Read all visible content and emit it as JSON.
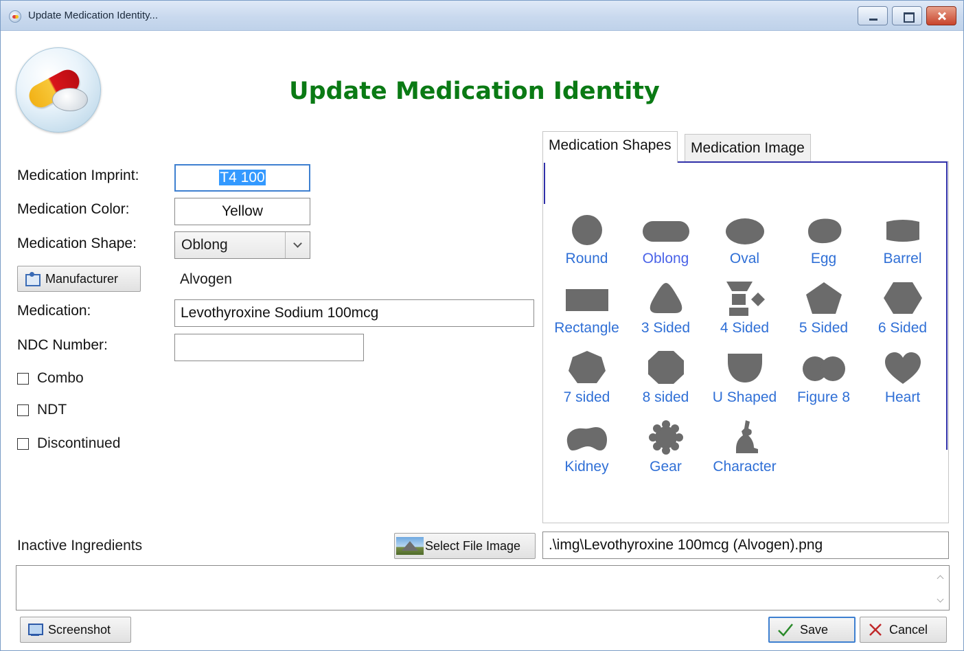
{
  "window": {
    "title": "Update Medication Identity...",
    "heading": "Update Medication Identity"
  },
  "form": {
    "imprint": {
      "label": "Medication Imprint:",
      "value": "T4 100"
    },
    "color": {
      "label": "Medication Color:",
      "value": "Yellow"
    },
    "shape": {
      "label": "Medication Shape:",
      "value": "Oblong"
    },
    "manufacturer": {
      "button": "Manufacturer",
      "value": "Alvogen"
    },
    "medication": {
      "label": "Medication:",
      "value": "Levothyroxine Sodium 100mcg"
    },
    "ndc": {
      "label": "NDC Number:",
      "value": ""
    },
    "checkboxes": {
      "combo": {
        "label": "Combo",
        "checked": false
      },
      "ndt": {
        "label": "NDT",
        "checked": false
      },
      "discontinued": {
        "label": "Discontinued",
        "checked": false
      }
    }
  },
  "tabs": {
    "shapes": "Medication Shapes",
    "image": "Medication Image"
  },
  "shapes": [
    {
      "label": "Round",
      "icon": "round-shape-icon"
    },
    {
      "label": "Oblong",
      "icon": "oblong-shape-icon",
      "selected": true
    },
    {
      "label": "Oval",
      "icon": "oval-shape-icon"
    },
    {
      "label": "Egg",
      "icon": "egg-shape-icon"
    },
    {
      "label": "Barrel",
      "icon": "barrel-shape-icon"
    },
    {
      "label": "Rectangle",
      "icon": "rectangle-shape-icon"
    },
    {
      "label": "3 Sided",
      "icon": "three-sided-shape-icon"
    },
    {
      "label": "4 Sided",
      "icon": "four-sided-shape-icon"
    },
    {
      "label": "5 Sided",
      "icon": "pentagon-shape-icon"
    },
    {
      "label": "6 Sided",
      "icon": "hexagon-shape-icon"
    },
    {
      "label": "7 sided",
      "icon": "heptagon-shape-icon"
    },
    {
      "label": "8 sided",
      "icon": "octagon-shape-icon"
    },
    {
      "label": "U Shaped",
      "icon": "u-shape-icon"
    },
    {
      "label": "Figure 8",
      "icon": "figure-eight-shape-icon"
    },
    {
      "label": "Heart",
      "icon": "heart-shape-icon"
    },
    {
      "label": "Kidney",
      "icon": "kidney-shape-icon"
    },
    {
      "label": "Gear",
      "icon": "gear-shape-icon"
    },
    {
      "label": "Character",
      "icon": "rabbit-character-icon"
    }
  ],
  "image": {
    "select_button": "Select File Image",
    "path": ".\\img\\Levothyroxine 100mcg (Alvogen).png"
  },
  "inactive_ingredients": {
    "label": "Inactive Ingredients",
    "value": ""
  },
  "footer": {
    "screenshot": "Screenshot",
    "save": "Save",
    "cancel": "Cancel"
  },
  "colors": {
    "heading": "#0a7a14",
    "shape_fill": "#6b6b6b",
    "shape_label": "#2f6fd6",
    "selection": "#3399ff"
  }
}
